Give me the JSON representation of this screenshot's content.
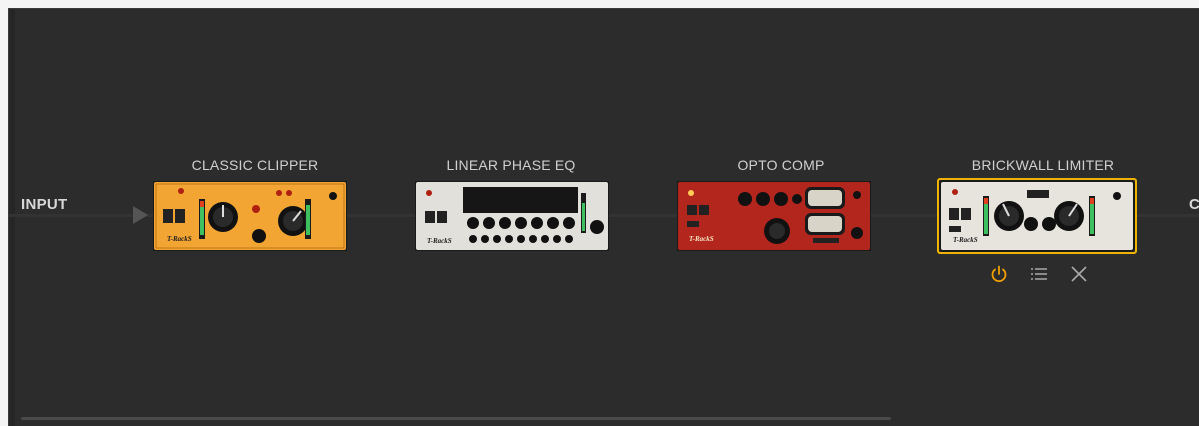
{
  "chain": {
    "input_label": "INPUT",
    "output_label": "C",
    "plugins": [
      {
        "title": "CLASSIC CLIPPER",
        "brand": "T-RackS"
      },
      {
        "title": "LINEAR PHASE EQ",
        "brand": "T-RackS"
      },
      {
        "title": "OPTO COMP",
        "brand": "T-RackS"
      },
      {
        "title": "BRICKWALL LIMITER",
        "brand": "T-RackS",
        "selected": true
      }
    ]
  },
  "selected_controls": [
    "power-icon",
    "menu-icon",
    "close-icon"
  ],
  "colors": {
    "background": "#2c2c2c",
    "selection": "#f0b400",
    "clipper": "#f0a030",
    "eq": "#dcdcd6",
    "comp": "#b3261e",
    "limiter": "#e6e4dc",
    "accent_icon": "#f0a000"
  }
}
